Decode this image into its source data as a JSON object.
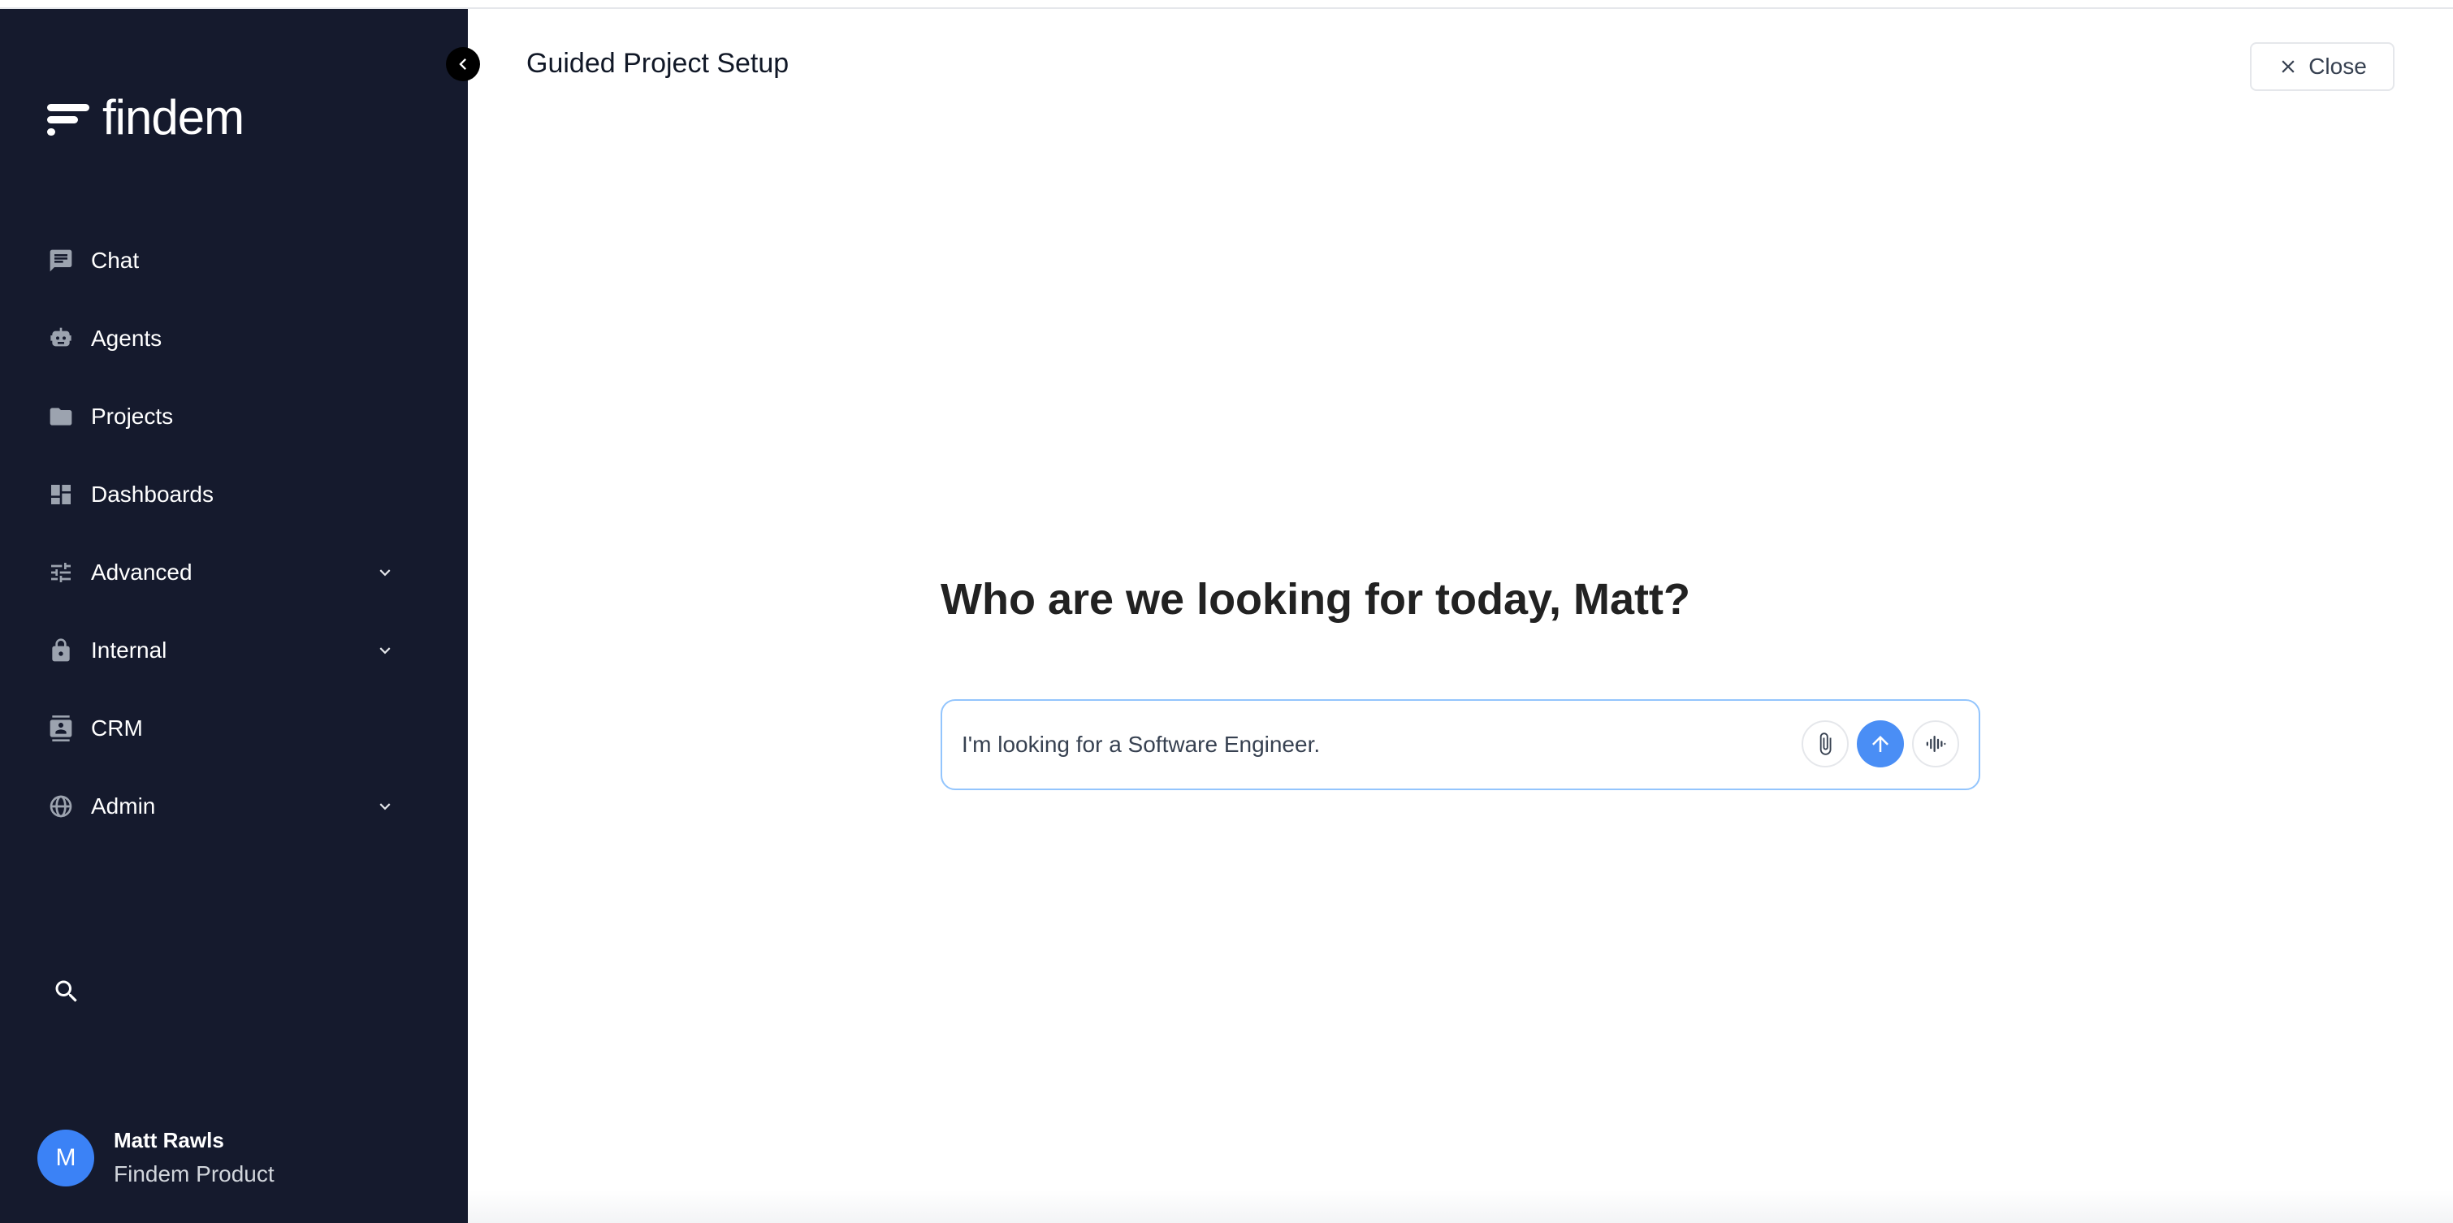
{
  "app": {
    "logo_text": "findem"
  },
  "sidebar": {
    "items": [
      {
        "label": "Chat",
        "icon": "chat-icon"
      },
      {
        "label": "Agents",
        "icon": "robot-icon"
      },
      {
        "label": "Projects",
        "icon": "folder-icon"
      },
      {
        "label": "Dashboards",
        "icon": "dashboard-icon"
      },
      {
        "label": "Advanced",
        "icon": "tune-icon",
        "expandable": true
      },
      {
        "label": "Internal",
        "icon": "lock-icon",
        "expandable": true
      },
      {
        "label": "CRM",
        "icon": "contact-card-icon"
      },
      {
        "label": "Admin",
        "icon": "globe-icon",
        "expandable": true
      }
    ],
    "search_icon": "search-icon",
    "user": {
      "initial": "M",
      "name": "Matt Rawls",
      "org": "Findem Product"
    }
  },
  "header": {
    "title": "Guided Project Setup",
    "close_label": "Close"
  },
  "main": {
    "headline": "Who are we looking for today, Matt?",
    "input_value": "I'm looking for a Software Engineer."
  },
  "colors": {
    "sidebar_bg": "#151a2d",
    "accent": "#4a8ef5",
    "input_border": "#93c5fd"
  }
}
